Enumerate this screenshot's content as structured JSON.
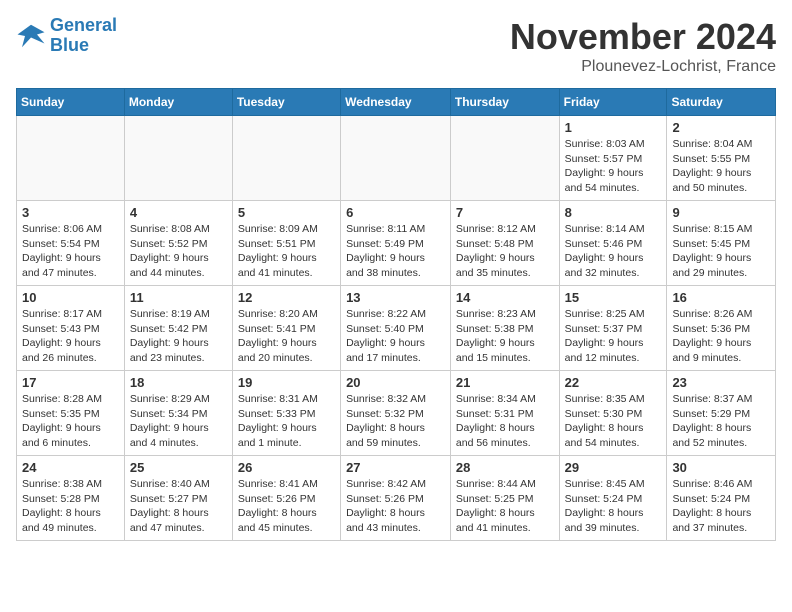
{
  "logo": {
    "line1": "General",
    "line2": "Blue"
  },
  "title": "November 2024",
  "location": "Plounevez-Lochrist, France",
  "days_of_week": [
    "Sunday",
    "Monday",
    "Tuesday",
    "Wednesday",
    "Thursday",
    "Friday",
    "Saturday"
  ],
  "weeks": [
    [
      {
        "day": "",
        "info": ""
      },
      {
        "day": "",
        "info": ""
      },
      {
        "day": "",
        "info": ""
      },
      {
        "day": "",
        "info": ""
      },
      {
        "day": "",
        "info": ""
      },
      {
        "day": "1",
        "info": "Sunrise: 8:03 AM\nSunset: 5:57 PM\nDaylight: 9 hours\nand 54 minutes."
      },
      {
        "day": "2",
        "info": "Sunrise: 8:04 AM\nSunset: 5:55 PM\nDaylight: 9 hours\nand 50 minutes."
      }
    ],
    [
      {
        "day": "3",
        "info": "Sunrise: 8:06 AM\nSunset: 5:54 PM\nDaylight: 9 hours\nand 47 minutes."
      },
      {
        "day": "4",
        "info": "Sunrise: 8:08 AM\nSunset: 5:52 PM\nDaylight: 9 hours\nand 44 minutes."
      },
      {
        "day": "5",
        "info": "Sunrise: 8:09 AM\nSunset: 5:51 PM\nDaylight: 9 hours\nand 41 minutes."
      },
      {
        "day": "6",
        "info": "Sunrise: 8:11 AM\nSunset: 5:49 PM\nDaylight: 9 hours\nand 38 minutes."
      },
      {
        "day": "7",
        "info": "Sunrise: 8:12 AM\nSunset: 5:48 PM\nDaylight: 9 hours\nand 35 minutes."
      },
      {
        "day": "8",
        "info": "Sunrise: 8:14 AM\nSunset: 5:46 PM\nDaylight: 9 hours\nand 32 minutes."
      },
      {
        "day": "9",
        "info": "Sunrise: 8:15 AM\nSunset: 5:45 PM\nDaylight: 9 hours\nand 29 minutes."
      }
    ],
    [
      {
        "day": "10",
        "info": "Sunrise: 8:17 AM\nSunset: 5:43 PM\nDaylight: 9 hours\nand 26 minutes."
      },
      {
        "day": "11",
        "info": "Sunrise: 8:19 AM\nSunset: 5:42 PM\nDaylight: 9 hours\nand 23 minutes."
      },
      {
        "day": "12",
        "info": "Sunrise: 8:20 AM\nSunset: 5:41 PM\nDaylight: 9 hours\nand 20 minutes."
      },
      {
        "day": "13",
        "info": "Sunrise: 8:22 AM\nSunset: 5:40 PM\nDaylight: 9 hours\nand 17 minutes."
      },
      {
        "day": "14",
        "info": "Sunrise: 8:23 AM\nSunset: 5:38 PM\nDaylight: 9 hours\nand 15 minutes."
      },
      {
        "day": "15",
        "info": "Sunrise: 8:25 AM\nSunset: 5:37 PM\nDaylight: 9 hours\nand 12 minutes."
      },
      {
        "day": "16",
        "info": "Sunrise: 8:26 AM\nSunset: 5:36 PM\nDaylight: 9 hours\nand 9 minutes."
      }
    ],
    [
      {
        "day": "17",
        "info": "Sunrise: 8:28 AM\nSunset: 5:35 PM\nDaylight: 9 hours\nand 6 minutes."
      },
      {
        "day": "18",
        "info": "Sunrise: 8:29 AM\nSunset: 5:34 PM\nDaylight: 9 hours\nand 4 minutes."
      },
      {
        "day": "19",
        "info": "Sunrise: 8:31 AM\nSunset: 5:33 PM\nDaylight: 9 hours\nand 1 minute."
      },
      {
        "day": "20",
        "info": "Sunrise: 8:32 AM\nSunset: 5:32 PM\nDaylight: 8 hours\nand 59 minutes."
      },
      {
        "day": "21",
        "info": "Sunrise: 8:34 AM\nSunset: 5:31 PM\nDaylight: 8 hours\nand 56 minutes."
      },
      {
        "day": "22",
        "info": "Sunrise: 8:35 AM\nSunset: 5:30 PM\nDaylight: 8 hours\nand 54 minutes."
      },
      {
        "day": "23",
        "info": "Sunrise: 8:37 AM\nSunset: 5:29 PM\nDaylight: 8 hours\nand 52 minutes."
      }
    ],
    [
      {
        "day": "24",
        "info": "Sunrise: 8:38 AM\nSunset: 5:28 PM\nDaylight: 8 hours\nand 49 minutes."
      },
      {
        "day": "25",
        "info": "Sunrise: 8:40 AM\nSunset: 5:27 PM\nDaylight: 8 hours\nand 47 minutes."
      },
      {
        "day": "26",
        "info": "Sunrise: 8:41 AM\nSunset: 5:26 PM\nDaylight: 8 hours\nand 45 minutes."
      },
      {
        "day": "27",
        "info": "Sunrise: 8:42 AM\nSunset: 5:26 PM\nDaylight: 8 hours\nand 43 minutes."
      },
      {
        "day": "28",
        "info": "Sunrise: 8:44 AM\nSunset: 5:25 PM\nDaylight: 8 hours\nand 41 minutes."
      },
      {
        "day": "29",
        "info": "Sunrise: 8:45 AM\nSunset: 5:24 PM\nDaylight: 8 hours\nand 39 minutes."
      },
      {
        "day": "30",
        "info": "Sunrise: 8:46 AM\nSunset: 5:24 PM\nDaylight: 8 hours\nand 37 minutes."
      }
    ]
  ]
}
